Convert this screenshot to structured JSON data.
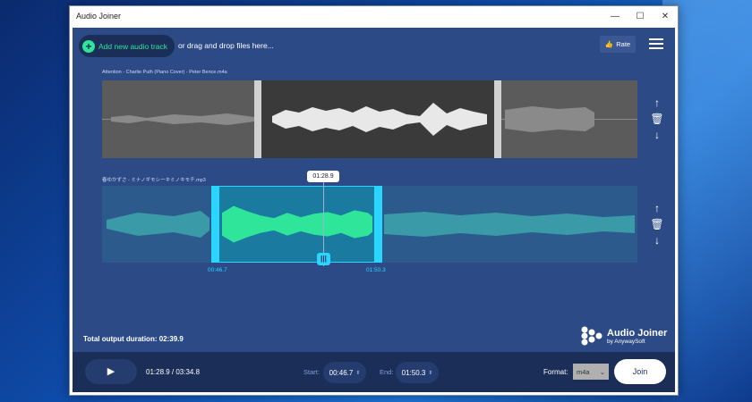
{
  "window": {
    "title": "Audio Joiner",
    "controls": [
      "—",
      "☐",
      "✕"
    ]
  },
  "toolbar": {
    "add_label": "Add new audio track",
    "drag_text": "or drag and drop files here...",
    "rate_label": "Rate"
  },
  "tracks": [
    {
      "name": "Attention - Charlie Puth (Piano Cover) - Peter Bence.m4a"
    },
    {
      "name": "春ゆかずさ - ミナノギモシーキミノキモチ.mp3"
    }
  ],
  "cursor": {
    "label": "01:28.9"
  },
  "selection": {
    "start": "00:46.7",
    "end": "01:50.3"
  },
  "total": {
    "label": "Total output duration: 02:39.9"
  },
  "logo": {
    "title": "Audio Joiner",
    "subtitle": "by AnywaySoft"
  },
  "bottombar": {
    "position": "01:28.9 / 03:34.8",
    "start_label": "Start:",
    "start_value": "00:46.7",
    "end_label": "End:",
    "end_value": "01:50.3",
    "format_label": "Format:",
    "format_value": "m4a",
    "join_label": "Join"
  },
  "colors": {
    "accent_green": "#2ee59a",
    "accent_cyan": "#2ad6ff",
    "panel": "#2b4a86",
    "bar": "#1a2e57"
  }
}
